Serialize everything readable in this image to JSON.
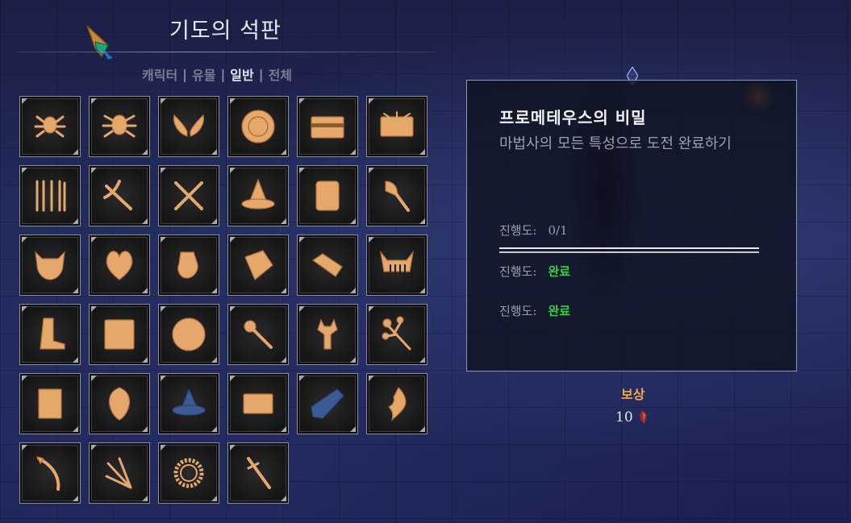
{
  "header": {
    "title": "기도의 석판",
    "filters": [
      {
        "label": "캐릭터",
        "active": false
      },
      {
        "label": "유물",
        "active": false
      },
      {
        "label": "일반",
        "active": true
      },
      {
        "label": "전체",
        "active": false
      }
    ],
    "separator": "|"
  },
  "grid": {
    "items": [
      {
        "icon": "spider-crest-icon",
        "dim": false
      },
      {
        "icon": "spider-crest-alt-icon",
        "dim": false
      },
      {
        "icon": "wings-icon",
        "dim": false
      },
      {
        "icon": "round-shield-icon",
        "dim": false
      },
      {
        "icon": "treasure-chest-icon",
        "dim": false
      },
      {
        "icon": "ornate-chest-icon",
        "dim": false
      },
      {
        "icon": "weapon-rack-icon",
        "dim": false
      },
      {
        "icon": "crossbow-icon",
        "dim": false
      },
      {
        "icon": "crossed-blades-icon",
        "dim": false
      },
      {
        "icon": "witch-hat-icon",
        "dim": false
      },
      {
        "icon": "scroll-icon",
        "dim": false
      },
      {
        "icon": "battle-axe-icon",
        "dim": false
      },
      {
        "icon": "beast-skull-icon",
        "dim": false
      },
      {
        "icon": "heart-icon",
        "dim": false
      },
      {
        "icon": "pouch-icon",
        "dim": false
      },
      {
        "icon": "parchment-icon",
        "dim": false
      },
      {
        "icon": "whetstone-icon",
        "dim": false
      },
      {
        "icon": "jaw-trap-icon",
        "dim": false
      },
      {
        "icon": "boot-icon",
        "dim": false
      },
      {
        "icon": "rune-tablet-icon",
        "dim": false
      },
      {
        "icon": "coin-icon",
        "dim": false
      },
      {
        "icon": "mace-icon",
        "dim": false
      },
      {
        "icon": "demon-idol-icon",
        "dim": false
      },
      {
        "icon": "flower-staff-icon",
        "dim": false
      },
      {
        "icon": "book-icon",
        "dim": false
      },
      {
        "icon": "mask-icon",
        "dim": false
      },
      {
        "icon": "wizard-hat-locked-icon",
        "dim": true
      },
      {
        "icon": "plank-icon",
        "dim": false
      },
      {
        "icon": "bandage-locked-icon",
        "dim": true
      },
      {
        "icon": "flame-sigil-icon",
        "dim": false
      },
      {
        "icon": "curved-bow-icon",
        "dim": false
      },
      {
        "icon": "staff-bundle-icon",
        "dim": false
      },
      {
        "icon": "sun-ring-icon",
        "dim": false
      },
      {
        "icon": "holy-sword-icon",
        "dim": false
      }
    ]
  },
  "detail": {
    "title": "프로메테우스의 비밀",
    "description": "마법사의 모든 특성으로 도전 완료하기",
    "progress_rows": [
      {
        "label": "진행도:",
        "value": "0/1",
        "done": false
      },
      {
        "label": "진행도:",
        "value": "완료",
        "done": true
      },
      {
        "label": "진행도:",
        "value": "완료",
        "done": true
      }
    ],
    "progress_fraction": 0
  },
  "reward": {
    "label": "보상",
    "value": "10",
    "icon": "crystal-shard-icon"
  },
  "colors": {
    "relic": "#e6a76a",
    "locked": "#3c5a93",
    "done": "#36d13b",
    "reward_label": "#f0a84a"
  }
}
